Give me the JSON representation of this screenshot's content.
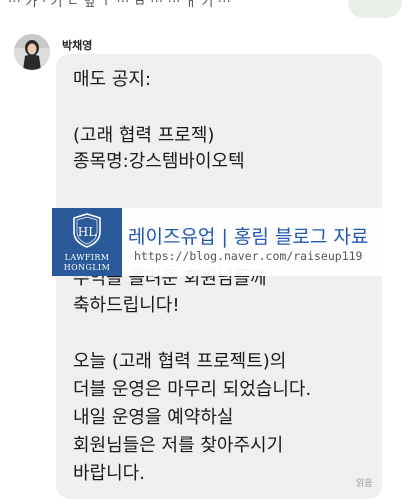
{
  "top_previous_text": "··· 가 · 기  ㄴ 잎 ㅜ ···                    ㅂ ···                       ··· ㅐ 기 ···",
  "sender": {
    "name": "박채영"
  },
  "message": {
    "lines": [
      "매도 공지:",
      "(고래 협력 프로젝)",
      "종목명:강스템바이오텍",
      "수익을 올려준 회원님들께",
      "축하드립니다!",
      "오늘 (고래 협력 프로젝트)의",
      "더블 운영은 마무리 되었습니다.",
      "내일 운영을 예약하실",
      "회원님들은 저를 찾아주시기",
      "바랍니다."
    ],
    "read_status": "읽음"
  },
  "watermark": {
    "brand_line1": "LAWFIRM",
    "brand_line2": "HONGLIM",
    "logo_letters": "HL",
    "title": "레이즈유업 | 홍림 블로그 자료",
    "url": "https://blog.naver.com/raiseup119"
  },
  "colors": {
    "bubble_bg": "#efefef",
    "watermark_title": "#2257b4",
    "logo_bg": "#2a5a99"
  }
}
